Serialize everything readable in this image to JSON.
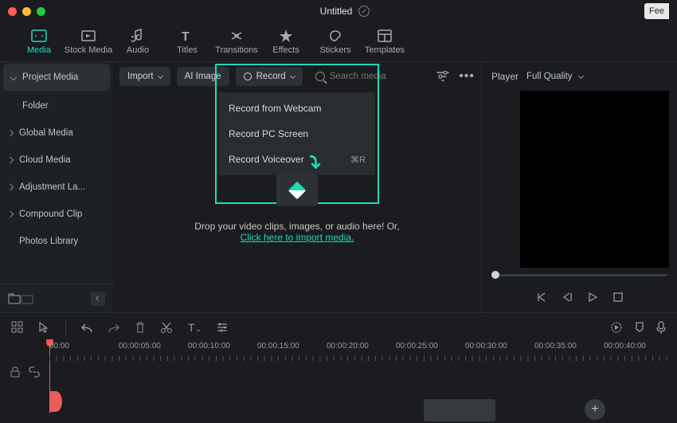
{
  "titlebar": {
    "title": "Untitled",
    "right_btn": "Fee"
  },
  "tabs": [
    {
      "label": "Media",
      "active": true
    },
    {
      "label": "Stock Media"
    },
    {
      "label": "Audio"
    },
    {
      "label": "Titles"
    },
    {
      "label": "Transitions"
    },
    {
      "label": "Effects"
    },
    {
      "label": "Stickers"
    },
    {
      "label": "Templates"
    }
  ],
  "sidebar": {
    "header": "Project Media",
    "items": [
      {
        "label": "Folder",
        "indent": true
      },
      {
        "label": "Global Media"
      },
      {
        "label": "Cloud Media"
      },
      {
        "label": "Adjustment La..."
      },
      {
        "label": "Compound Clip"
      },
      {
        "label": "Photos Library",
        "nocaret": true
      }
    ]
  },
  "toolbar": {
    "import": "Import",
    "ai_image": "AI Image",
    "record": "Record",
    "search_placeholder": "Search media"
  },
  "dropdown": {
    "items": [
      {
        "label": "Record from Webcam"
      },
      {
        "label": "Record PC Screen"
      },
      {
        "label": "Record Voiceover",
        "shortcut": "⌘R"
      }
    ]
  },
  "dropzone": {
    "text": "Drop your video clips, images, or audio here! Or,",
    "link": "Click here to import media."
  },
  "player": {
    "label": "Player",
    "quality": "Full Quality"
  },
  "timeline": {
    "stamps": [
      "00:00",
      "00:00:05:00",
      "00:00:10:00",
      "00:00:15:00",
      "00:00:20:00",
      "00:00:25:00",
      "00:00:30:00",
      "00:00:35:00",
      "00:00:40:00"
    ]
  }
}
